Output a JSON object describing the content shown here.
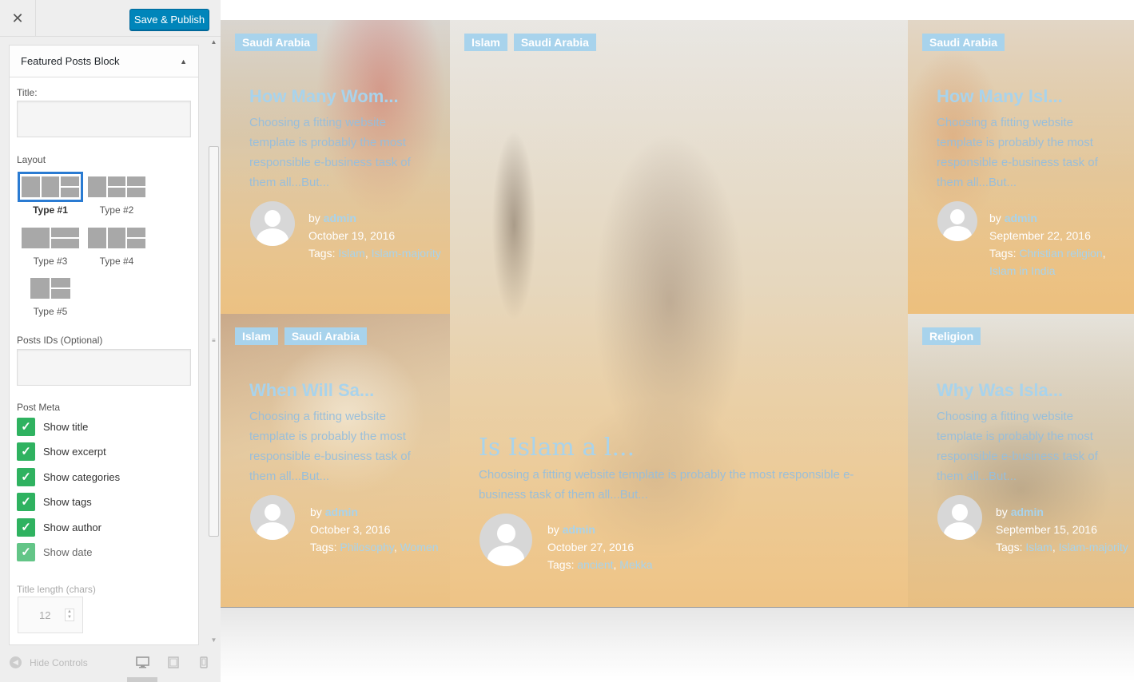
{
  "panel": {
    "save_label": "Save & Publish",
    "section_title": "Featured Posts Block",
    "title_label": "Title:",
    "title_value": "",
    "layout_label": "Layout",
    "layouts": [
      "Type #1",
      "Type #2",
      "Type #3",
      "Type #4",
      "Type #5"
    ],
    "selected_layout": "Type #1",
    "posts_ids_label": "Posts IDs (Optional)",
    "posts_ids_value": "",
    "post_meta_label": "Post Meta",
    "post_meta": [
      "Show title",
      "Show excerpt",
      "Show categories",
      "Show tags",
      "Show author",
      "Show date"
    ],
    "title_length_label": "Title length (chars)",
    "title_length_value": "12",
    "hide_controls_label": "Hide Controls"
  },
  "posts": [
    {
      "categories": [
        "Saudi Arabia"
      ],
      "title": "How Many Wom...",
      "excerpt": "Choosing a fitting website template is probably the most responsible e-business task of them all...But...",
      "by": "by",
      "author": "admin",
      "date": "October 19, 2016",
      "tags_label": "Tags:",
      "tags": [
        "Islam",
        "Islam-majority"
      ]
    },
    {
      "categories": [
        "Islam",
        "Saudi Arabia"
      ],
      "title": "Is Islam a l...",
      "excerpt": "Choosing a fitting website template is probably the most responsible e-business task of them all...But...",
      "by": "by",
      "author": "admin",
      "date": "October 27, 2016",
      "tags_label": "Tags:",
      "tags": [
        "ancient",
        "Mekka"
      ]
    },
    {
      "categories": [
        "Saudi Arabia"
      ],
      "title": "How Many Isl...",
      "excerpt": "Choosing a fitting website template is probably the most responsible e-business task of them all...But...",
      "by": "by",
      "author": "admin",
      "date": "September 22, 2016",
      "tags_label": "Tags:",
      "tags": [
        "Christian religion",
        "Islam in India"
      ]
    },
    {
      "categories": [
        "Islam",
        "Saudi Arabia"
      ],
      "title": "When Will Sa...",
      "excerpt": "Choosing a fitting website template is probably the most responsible e-business task of them all...But...",
      "by": "by",
      "author": "admin",
      "date": "October 3, 2016",
      "tags_label": "Tags:",
      "tags": [
        "Philosophy",
        "Women"
      ]
    },
    {
      "categories": [
        "Religion"
      ],
      "title": "Why Was Isla...",
      "excerpt": "Choosing a fitting website template is probably the most responsible e-business task of them all...But...",
      "by": "by",
      "author": "admin",
      "date": "September 15, 2016",
      "tags_label": "Tags:",
      "tags": [
        "Islam",
        "Islam-majority"
      ]
    }
  ],
  "icons": {
    "close": "close-icon",
    "collapse": "arrow-up-icon",
    "check": "checkmark-icon",
    "desktop": "desktop-icon",
    "tablet": "tablet-icon",
    "mobile": "mobile-icon"
  },
  "colors": {
    "primary_button": "#0085ba",
    "checkbox": "#2fb260",
    "category_badge": "#a8d3ec",
    "selected_layout_border": "#2a7bd2"
  }
}
